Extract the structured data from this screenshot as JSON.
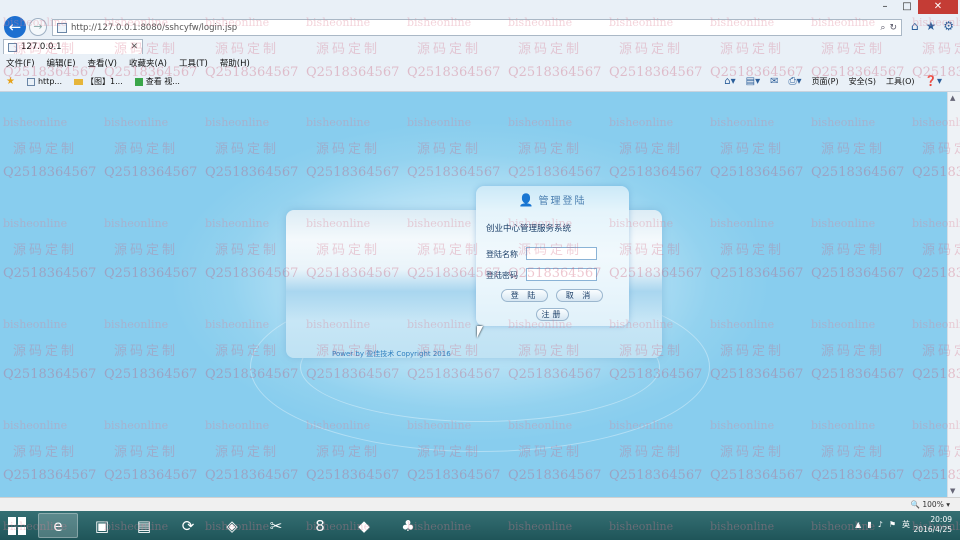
{
  "browser": {
    "url": "http://127.0.0.1:8080/sshcyfw/login.jsp",
    "tab_title": "127.0.0.1",
    "window_controls": [
      "–",
      "□",
      "✕"
    ],
    "address_icons": [
      "search-icon",
      "refresh-icon"
    ],
    "right_icons": [
      "home-icon",
      "star-icon",
      "gear-icon"
    ],
    "menu": [
      "文件(F)",
      "编辑(E)",
      "查看(V)",
      "收藏夹(A)",
      "工具(T)",
      "帮助(H)"
    ],
    "favorites": [
      {
        "label": "http...",
        "icon": "page-icon"
      },
      {
        "label": "【图】1...",
        "icon": "folder-icon"
      },
      {
        "label": "查看 视...",
        "icon": "green-page-icon"
      }
    ],
    "command_bar": [
      "页面(P)",
      "安全(S)",
      "工具(O)"
    ]
  },
  "login": {
    "header": "管理登陆",
    "system_name": "创业中心管理服务系统",
    "username_label": "登陆名称",
    "password_label": "登陆密码",
    "login_button": "登 陆",
    "cancel_button": "取 消",
    "register_button": "注册",
    "powered_by": "Power by 盈佳技术 Copyright 2016"
  },
  "watermark": {
    "site": "bisheonline",
    "cn": "源码定制",
    "qq": "Q2518364567"
  },
  "status": {
    "zoom": "100%"
  },
  "taskbar": {
    "apps": [
      "e",
      "▣",
      "▤",
      "⟳",
      "◈",
      "✂",
      "8",
      "◆",
      "♣"
    ],
    "tray_text": "英",
    "time": "20:09",
    "date": "2016/4/25"
  },
  "colors": {
    "accent": "#1c6fd0",
    "content_bg": "#93d2ef",
    "taskbar": "#2a6266"
  }
}
